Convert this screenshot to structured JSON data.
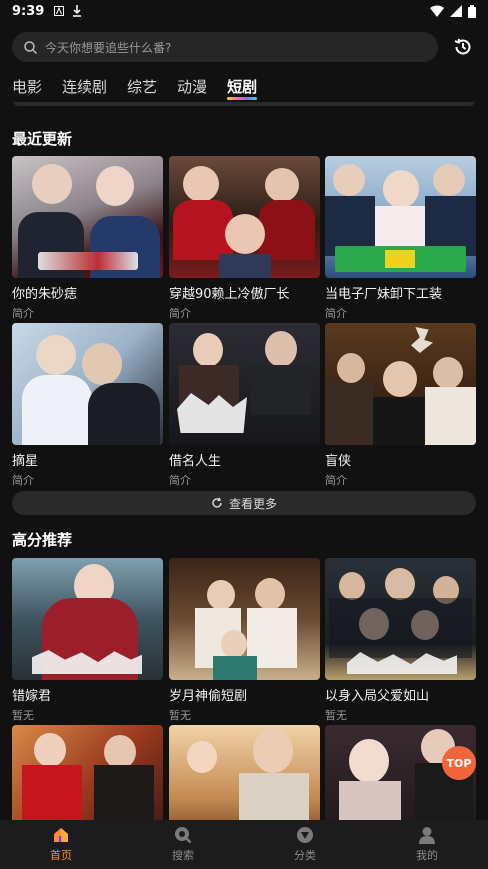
{
  "status_bar": {
    "time": "9:39"
  },
  "search": {
    "placeholder": "今天你想要追些什么番?"
  },
  "tabs": [
    {
      "label": "电影"
    },
    {
      "label": "连续剧"
    },
    {
      "label": "综艺"
    },
    {
      "label": "动漫"
    },
    {
      "label": "短剧"
    }
  ],
  "sections": {
    "recent": {
      "title": "最近更新",
      "items": [
        {
          "title": "你的朱砂痣",
          "sub": "简介"
        },
        {
          "title": "穿越90赖上冷傲厂长",
          "sub": "简介"
        },
        {
          "title": "当电子厂妹卸下工装",
          "sub": "简介"
        },
        {
          "title": "摘星",
          "sub": "简介"
        },
        {
          "title": "借名人生",
          "sub": "简介"
        },
        {
          "title": "盲侠",
          "sub": "简介"
        }
      ],
      "more_label": "查看更多"
    },
    "top_rated": {
      "title": "高分推荐",
      "items": [
        {
          "title": "错嫁君",
          "sub": "暂无"
        },
        {
          "title": "岁月神偷短剧",
          "sub": "暂无"
        },
        {
          "title": "以身入局父爱如山",
          "sub": "暂无"
        }
      ]
    }
  },
  "top_button": "TOP",
  "bottom_nav": [
    {
      "label": "首页",
      "icon": "home-icon"
    },
    {
      "label": "搜索",
      "icon": "search-icon"
    },
    {
      "label": "分类",
      "icon": "category-icon"
    },
    {
      "label": "我的",
      "icon": "profile-icon"
    }
  ],
  "colors": {
    "accent": "#ff8a34",
    "top_button": "#f2653a",
    "background": "#111111"
  }
}
